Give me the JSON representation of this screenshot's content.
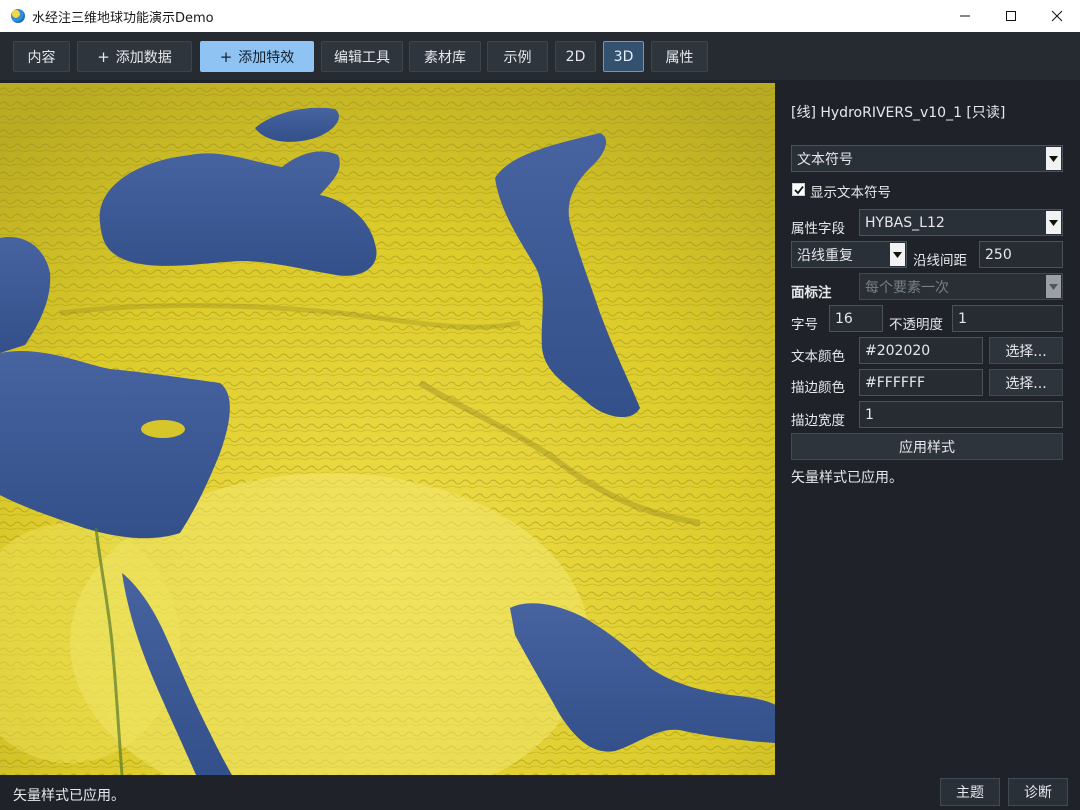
{
  "window": {
    "title": "水经注三维地球功能演示Demo",
    "controls": {
      "minimize": "minimize-icon",
      "maximize": "maximize-icon",
      "close": "close-icon"
    }
  },
  "toolbar": {
    "items": [
      {
        "label": "内容",
        "icon": ""
      },
      {
        "label": "添加数据",
        "icon": "+"
      },
      {
        "label": "添加特效",
        "icon": "+"
      },
      {
        "label": "编辑工具",
        "icon": ""
      },
      {
        "label": "素材库",
        "icon": ""
      },
      {
        "label": "示例",
        "icon": ""
      },
      {
        "label": "2D",
        "icon": ""
      },
      {
        "label": "3D",
        "icon": ""
      },
      {
        "label": "属性",
        "icon": ""
      }
    ],
    "highlighted": "添加特效",
    "active_view": "3D"
  },
  "panel": {
    "layer_title": "[线] HydroRIVERS_v10_1 [只读]",
    "symbol_type": "文本符号",
    "show_text_label": "显示文本符号",
    "show_text_checked": true,
    "attr_field_label": "属性字段",
    "attr_field_value": "HYBAS_L12",
    "line_mode_value": "沿线重复",
    "line_spacing_label": "沿线间距",
    "line_spacing_value": "250",
    "area_label": "面标注",
    "area_value": "每个要素一次",
    "font_size_label": "字号",
    "font_size_value": "16",
    "opacity_label": "不透明度",
    "opacity_value": "1",
    "text_color_label": "文本颜色",
    "text_color_value": "#202020",
    "text_color_button": "选择...",
    "stroke_color_label": "描边颜色",
    "stroke_color_value": "#FFFFFF",
    "stroke_color_button": "选择...",
    "stroke_width_label": "描边宽度",
    "stroke_width_value": "1",
    "apply_button": "应用样式",
    "message": "矢量样式已应用。"
  },
  "status": {
    "text": "矢量样式已应用。",
    "theme_button": "主题",
    "diagnose_button": "诊断"
  },
  "colors": {
    "accent": "#8fc3f4",
    "active_border": "#5f9bd4",
    "panel_bg": "#1f2329",
    "land": "#e2d22a",
    "water": "#3f5a94"
  }
}
